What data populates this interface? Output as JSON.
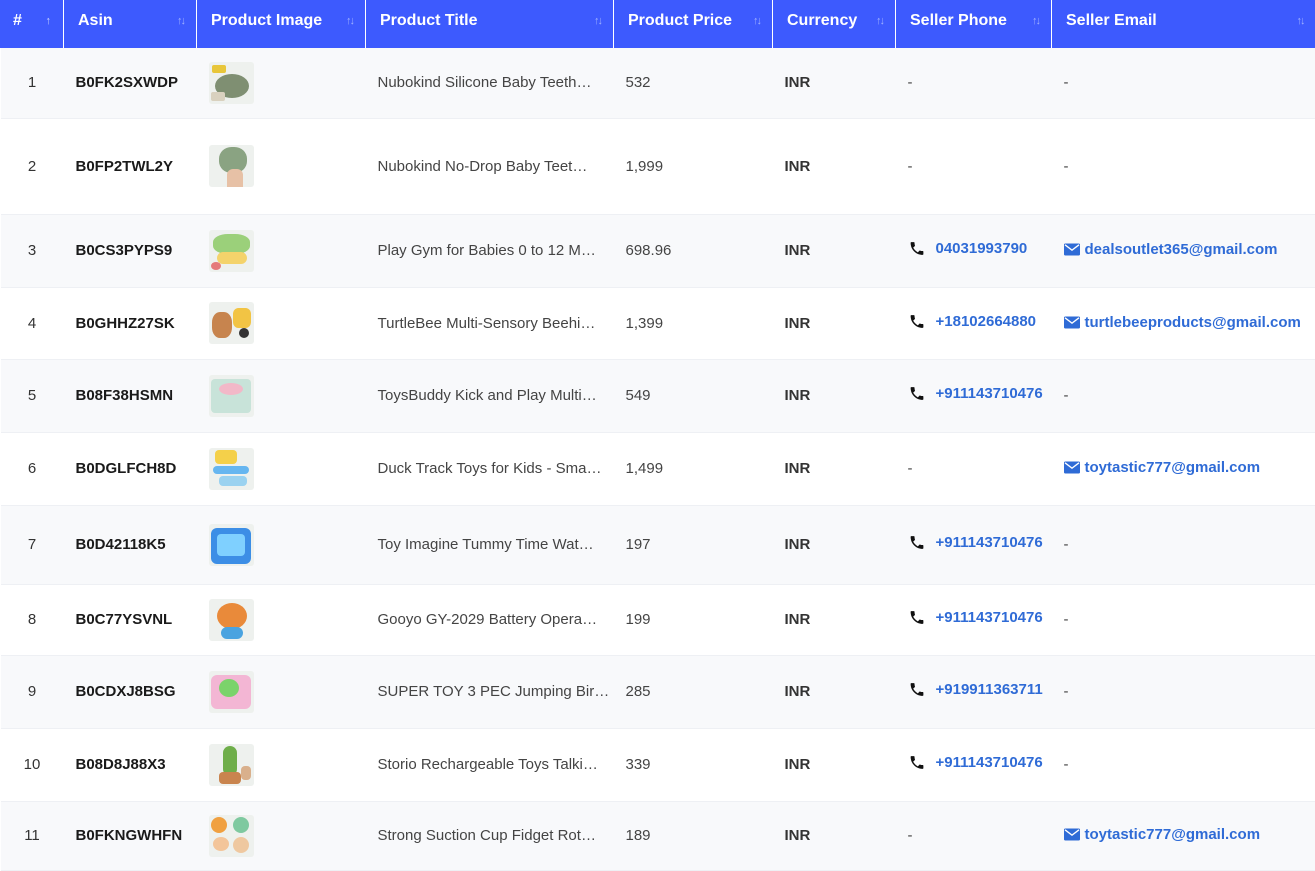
{
  "columns": [
    {
      "label": "#"
    },
    {
      "label": "Asin"
    },
    {
      "label": "Product Image"
    },
    {
      "label": "Product Title"
    },
    {
      "label": "Product Price"
    },
    {
      "label": "Currency"
    },
    {
      "label": "Seller Phone"
    },
    {
      "label": "Seller Email"
    }
  ],
  "rows": [
    {
      "idx": "1",
      "asin": "B0FK2SXWDP",
      "title": "Nubokind Silicone Baby Teeth…",
      "price": "532",
      "currency": "INR",
      "phone": "-",
      "email": "-"
    },
    {
      "idx": "2",
      "asin": "B0FP2TWL2Y",
      "title": "Nubokind No-Drop Baby Teet…",
      "price": "1,999",
      "currency": "INR",
      "phone": "-",
      "email": "-"
    },
    {
      "idx": "3",
      "asin": "B0CS3PYPS9",
      "title": "Play Gym for Babies 0 to 12 M…",
      "price": "698.96",
      "currency": "INR",
      "phone": "04031993790",
      "email": "dealsoutlet365@gmail.com"
    },
    {
      "idx": "4",
      "asin": "B0GHHZ27SK",
      "title": "TurtleBee Multi-Sensory Beehi…",
      "price": "1,399",
      "currency": "INR",
      "phone": "+18102664880",
      "email": "turtlebeeproducts@gmail.com"
    },
    {
      "idx": "5",
      "asin": "B08F38HSMN",
      "title": "ToysBuddy Kick and Play Multi…",
      "price": "549",
      "currency": "INR",
      "phone": "+911143710476",
      "email": "-"
    },
    {
      "idx": "6",
      "asin": "B0DGLFCH8D",
      "title": "Duck Track Toys for Kids - Sma…",
      "price": "1,499",
      "currency": "INR",
      "phone": "-",
      "email": "toytastic777@gmail.com"
    },
    {
      "idx": "7",
      "asin": "B0D42118K5",
      "title": "Toy Imagine Tummy Time Wat…",
      "price": "197",
      "currency": "INR",
      "phone": "+911143710476",
      "email": "-"
    },
    {
      "idx": "8",
      "asin": "B0C77YSVNL",
      "title": "Gooyo GY-2029 Battery Opera…",
      "price": "199",
      "currency": "INR",
      "phone": "+911143710476",
      "email": "-"
    },
    {
      "idx": "9",
      "asin": "B0CDXJ8BSG",
      "title": "SUPER TOY 3 PEC Jumping Bir…",
      "price": "285",
      "currency": "INR",
      "phone": "+919911363711",
      "email": "-"
    },
    {
      "idx": "10",
      "asin": "B08D8J88X3",
      "title": "Storio Rechargeable Toys Talki…",
      "price": "339",
      "currency": "INR",
      "phone": "+911143710476",
      "email": "-"
    },
    {
      "idx": "11",
      "asin": "B0FKNGWHFN",
      "title": "Strong Suction Cup Fidget Rot…",
      "price": "189",
      "currency": "INR",
      "phone": "-",
      "email": "toytastic777@gmail.com"
    }
  ],
  "theme": {
    "header_bg": "#3d5afe",
    "link_color": "#2f6bd6",
    "row_alt_bg": "#f8f9fb"
  },
  "icons": {
    "sort": "sort-arrows-icon",
    "sort_active": "sort-up-icon",
    "phone": "phone-icon",
    "email": "envelope-icon"
  }
}
